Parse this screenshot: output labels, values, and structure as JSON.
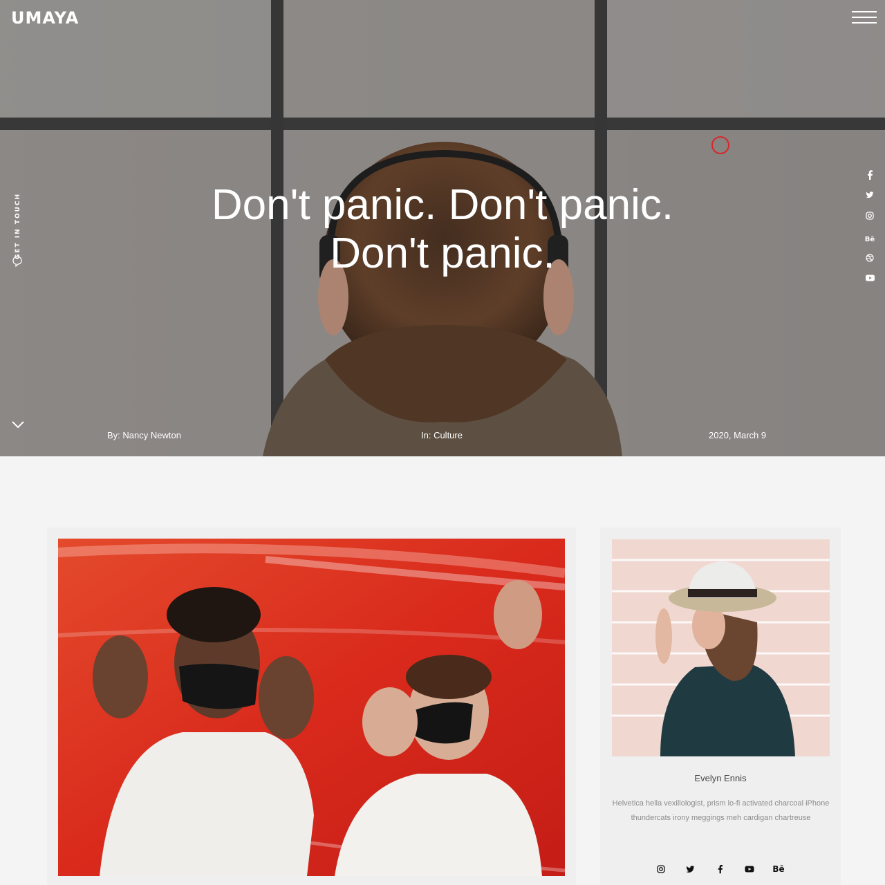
{
  "brand": {
    "logo_text": "UMAYA"
  },
  "nav": {
    "menu_icon": "hamburger-menu-icon"
  },
  "sidebar": {
    "get_in_touch_label": "GET IN TOUCH",
    "icon": "chat-bubble-icon",
    "scroll_icon": "chevron-down-icon"
  },
  "hero": {
    "title_line1": "Don't panic. Don't panic.",
    "title_line2": "Don't panic.",
    "meta": {
      "author": "By: Nancy Newton",
      "category": "In: Culture",
      "date": "2020, March 9"
    }
  },
  "social_rail": [
    {
      "icon": "facebook-icon"
    },
    {
      "icon": "twitter-icon"
    },
    {
      "icon": "instagram-icon"
    },
    {
      "icon": "behance-icon",
      "label": "Bē"
    },
    {
      "icon": "dribbble-icon"
    },
    {
      "icon": "youtube-icon"
    }
  ],
  "author_card": {
    "name": "Evelyn Ennis",
    "bio": "Helvetica hella vexillologist, prism lo-fi activated charcoal iPhone thundercats irony meggings meh cardigan chartreuse",
    "social": [
      {
        "icon": "instagram-icon"
      },
      {
        "icon": "twitter-icon"
      },
      {
        "icon": "facebook-icon"
      },
      {
        "icon": "youtube-icon"
      },
      {
        "icon": "behance-icon",
        "label": "Bē"
      }
    ]
  },
  "colors": {
    "accent_ring": "#d9262a",
    "page_bg": "#f4f4f4",
    "card_bg": "#efefef"
  }
}
